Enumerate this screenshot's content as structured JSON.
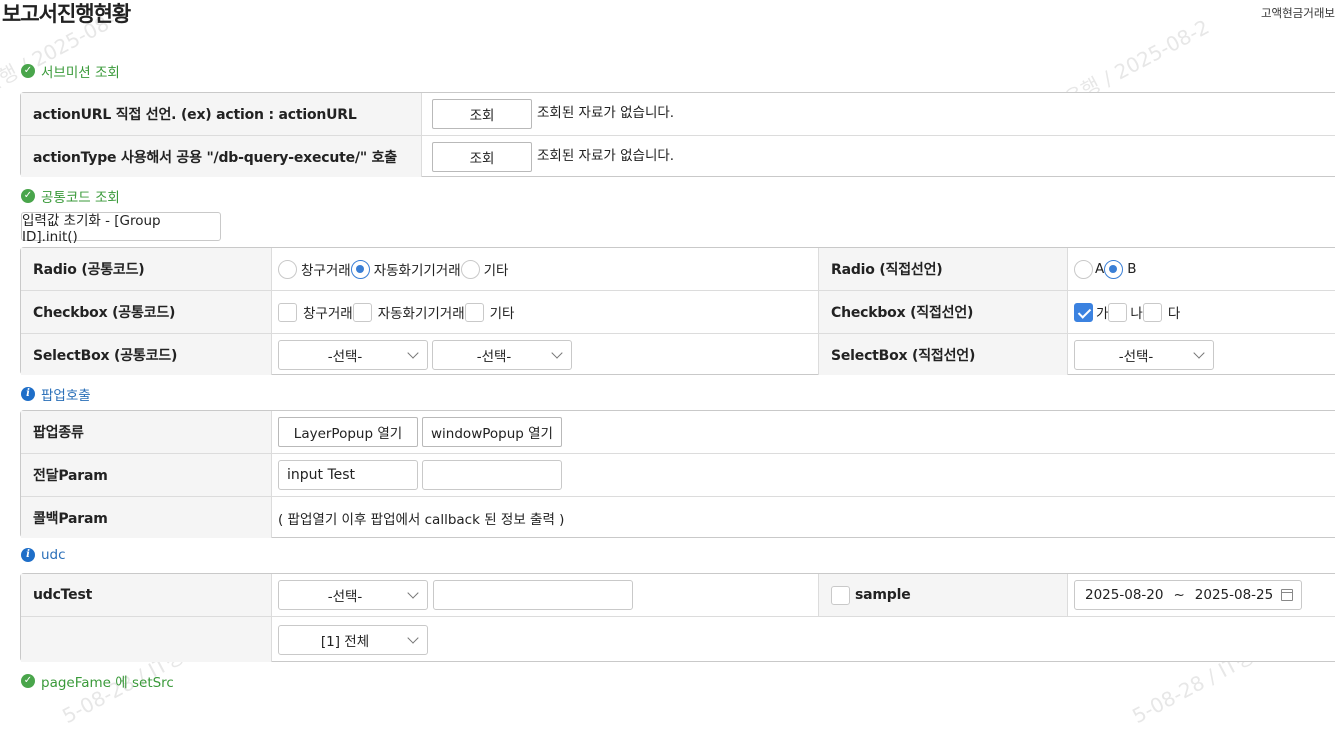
{
  "page": {
    "title": "보고서진행현황",
    "top_right": "고액현금거래보"
  },
  "watermark": {
    "text_a": "은행 / 2025-08-2",
    "text_b": "농협은행 / 2025-08-2",
    "text_c": "5-08-28 / IT경영관리팀/복주해",
    "text_d": "5-08-28 / IT경영관리"
  },
  "sections": {
    "submission": "서브미션 조회",
    "common_code": "공통코드 조회",
    "popup": "팝업호출",
    "udc": "udc",
    "pageframe": "pageFame 에 setSrc"
  },
  "submission_rows": [
    {
      "label": "actionURL 직접 선언. (ex) action : actionURL",
      "button": "조회",
      "result": "조회된 자료가 없습니다."
    },
    {
      "label": "actionType 사용해서 공용 \"/db-query-execute/\" 호출",
      "button": "조회",
      "result": "조회된 자료가 없습니다."
    }
  ],
  "init_button": "입력값 초기화 - [Group ID].init()",
  "common": {
    "radio_label": "Radio (공통코드)",
    "radio_options": [
      "창구거래",
      "자동화기기거래",
      "기타"
    ],
    "radio_selected": "자동화기기거래",
    "radio_direct_label": "Radio (직접선언)",
    "radio_direct_options": [
      "A",
      "B"
    ],
    "radio_direct_selected": "B",
    "checkbox_label": "Checkbox (공통코드)",
    "checkbox_options": [
      "창구거래",
      "자동화기기거래",
      "기타"
    ],
    "checkbox_direct_label": "Checkbox (직접선언)",
    "checkbox_direct_options": [
      "가",
      "나",
      "다"
    ],
    "checkbox_direct_checked": [
      "가"
    ],
    "select_label": "SelectBox (공통코드)",
    "select_value_1": "-선택-",
    "select_value_2": "-선택-",
    "select_direct_label": "SelectBox (직접선언)",
    "select_direct_value": "-선택-"
  },
  "popup": {
    "type_label": "팝업종류",
    "layer_button": "LayerPopup 열기",
    "window_button": "windowPopup 열기",
    "param_label": "전달Param",
    "param_value": "input Test",
    "param_value_2": "",
    "callback_label": "콜백Param",
    "callback_text": "( 팝업열기 이후 팝업에서 callback 된 정보 출력 )"
  },
  "udc": {
    "test_label": "udcTest",
    "select_value": "-선택-",
    "input_value": "",
    "sample_label": "sample",
    "sample_checked": false,
    "date_from": "2025-08-20",
    "date_sep": "~",
    "date_to": "2025-08-25",
    "select2_value": "[1] 전체"
  }
}
